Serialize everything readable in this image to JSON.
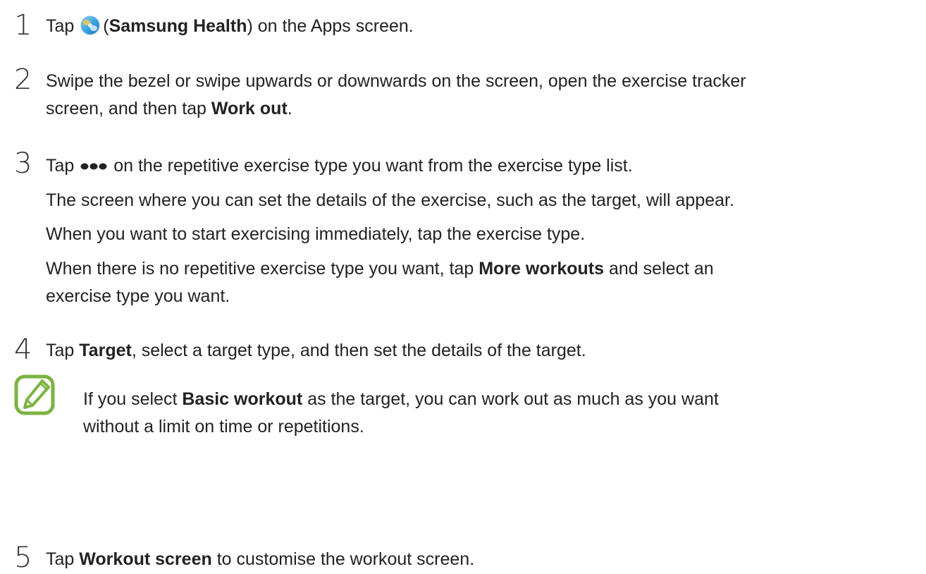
{
  "steps": [
    {
      "number": "1",
      "parts": {
        "a": "Tap",
        "b": "(",
        "c": "Samsung Health",
        "d": ") on the Apps screen."
      },
      "icon": "samsung-health-app-icon"
    },
    {
      "number": "2",
      "line1": "Swipe the bezel or swipe upwards or downwards on the screen, open the exercise tracker",
      "line2a": "screen, and then tap",
      "line2b": "Work out",
      "line2c": "."
    },
    {
      "number": "3",
      "line1a": "Tap",
      "line1b": "on the repetitive exercise type you want from the exercise type list.",
      "icon": "more-options-dots-icon",
      "para1": "The screen where you can set the details of the exercise, such as the target, will appear.",
      "para2": "When you want to start exercising immediately, tap the exercise type.",
      "para3a": "When there is no repetitive exercise type you want, tap",
      "para3b": "More workouts",
      "para3c": "and select an",
      "para3d": "exercise type you want."
    },
    {
      "number": "4",
      "line1a": "Tap",
      "line1b": "Target",
      "line1c": ", select a target type, and then set the details of the target."
    },
    {
      "number": "5",
      "line1a": "Tap",
      "line1b": "Workout screen",
      "line1c": "to customise the workout screen."
    }
  ],
  "note": {
    "icon": "note-pencil-icon",
    "line1a": "If you select",
    "line1b": "Basic workout",
    "line1c": "as the target, you can work out as much as you want",
    "line2": "without a limit on time or repetitions."
  },
  "colors": {
    "text": "#222222",
    "note_icon": "#7cb342"
  }
}
